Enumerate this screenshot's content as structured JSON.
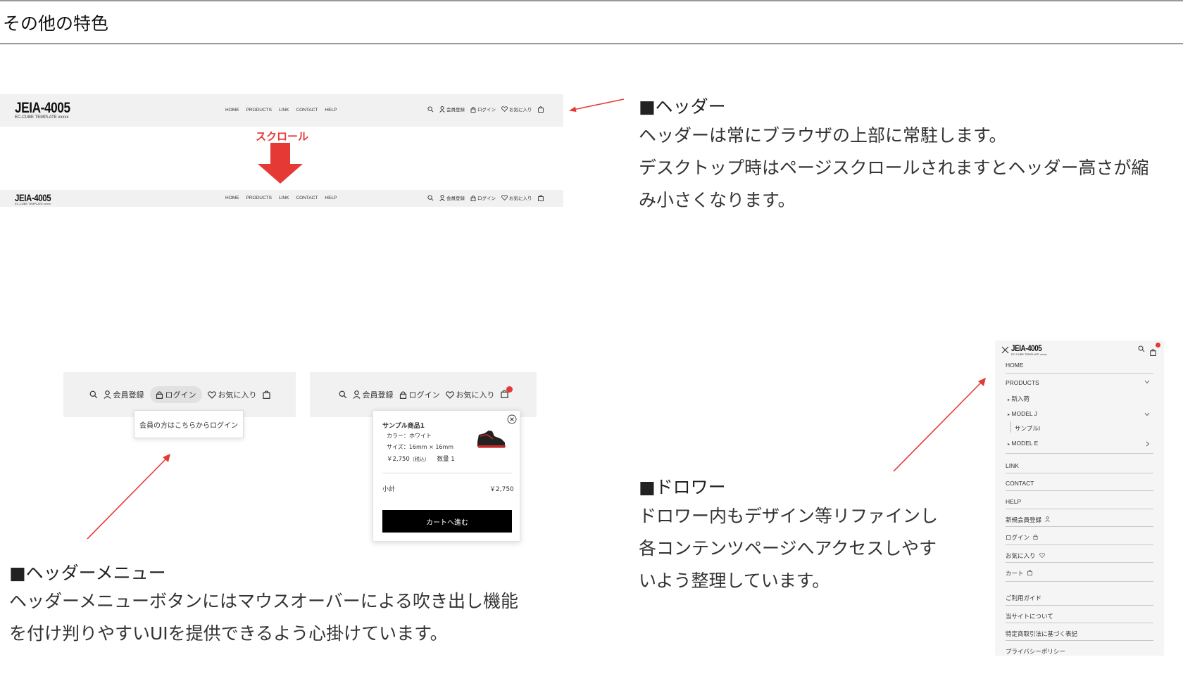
{
  "section": {
    "title": "その他の特色"
  },
  "header_demo": {
    "logo": "JEIA-4005",
    "logo_sub": "EC-CUBE TEMPLATE xxxxx",
    "nav": [
      "HOME",
      "PRODUCTS",
      "LINK",
      "CONTACT",
      "HELP"
    ],
    "util": {
      "register": "会員登録",
      "login": "ログイン",
      "favorite": "お気に入り"
    },
    "scroll_label": "スクロール"
  },
  "annotations": {
    "header": {
      "title": "■ヘッダー",
      "lines": [
        "ヘッダーは常にブラウザの上部に常駐します。",
        "デスクトップ時はページスクロールされますとヘッダー高さが縮",
        "み小さくなります。"
      ]
    },
    "menu": {
      "title": "■ヘッダーメニュー",
      "lines": [
        "ヘッダーメニューボタンにはマウスオーバーによる吹き出し機能",
        "を付け判りやすいUIを提供できるよう心掛けています。"
      ]
    },
    "drawer": {
      "title": "■ドロワー",
      "lines": [
        "ドロワー内もデザイン等リファインし",
        "各コンテンツページへアクセスしやす",
        "いよう整理しています。"
      ]
    }
  },
  "menu_demo": {
    "register": "会員登録",
    "login": "ログイン",
    "favorite": "お気に入り",
    "tooltip": "会員の方はこちらからログイン",
    "cart": {
      "product": "サンプル商品1",
      "color": "カラー：ホワイト",
      "size": "サイズ：16mm × 16mm",
      "price": "￥2,750",
      "tax": "（税込）",
      "qty": "数量 1",
      "subtotal_label": "小計",
      "subtotal": "￥2,750",
      "button": "カートへ進む"
    }
  },
  "drawer_demo": {
    "logo": "JEIA-4005",
    "logo_sub": "EC-CUBE TEMPLATE xxxxx",
    "home": "HOME",
    "products": "PRODUCTS",
    "new": "新入荷",
    "model_j": "MODEL J",
    "sample": "サンプルI",
    "model_e": "MODEL E",
    "link": "LINK",
    "contact": "CONTACT",
    "help": "HELP",
    "register": "新規会員登録",
    "login": "ログイン",
    "favorite": "お気に入り",
    "cart": "カート",
    "guide": "ご利用ガイド",
    "about": "当サイトについて",
    "law": "特定商取引法に基づく表記",
    "privacy": "プライバシーポリシー"
  },
  "colors": {
    "accent_red": "#e53935",
    "header_bg": "#f1f1f1",
    "button_black": "#000000"
  }
}
